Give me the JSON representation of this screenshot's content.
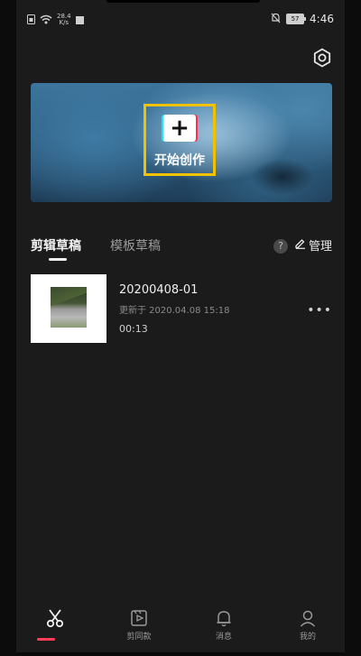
{
  "status_bar": {
    "net_speed_value": "28.4",
    "net_speed_unit": "K/s",
    "battery": "57",
    "time": "4:46"
  },
  "banner": {
    "create_label": "开始创作"
  },
  "tabs": [
    {
      "label": "剪辑草稿",
      "active": true
    },
    {
      "label": "模板草稿",
      "active": false
    }
  ],
  "toolbar": {
    "help_label": "?",
    "manage_label": "管理"
  },
  "drafts": [
    {
      "title": "20200408-01",
      "updated": "更新于 2020.04.08 15:18",
      "duration": "00:13",
      "more_label": "•••"
    }
  ],
  "bottom_nav": [
    {
      "label": "",
      "icon": "scissors-icon",
      "active": true
    },
    {
      "label": "剪同款",
      "icon": "template-icon",
      "active": false
    },
    {
      "label": "消息",
      "icon": "bell-icon",
      "active": false
    },
    {
      "label": "我的",
      "icon": "profile-icon",
      "active": false
    }
  ],
  "colors": {
    "background": "#1b1b1b",
    "highlight_box": "#f2c200",
    "accent": "#ff3d57"
  }
}
